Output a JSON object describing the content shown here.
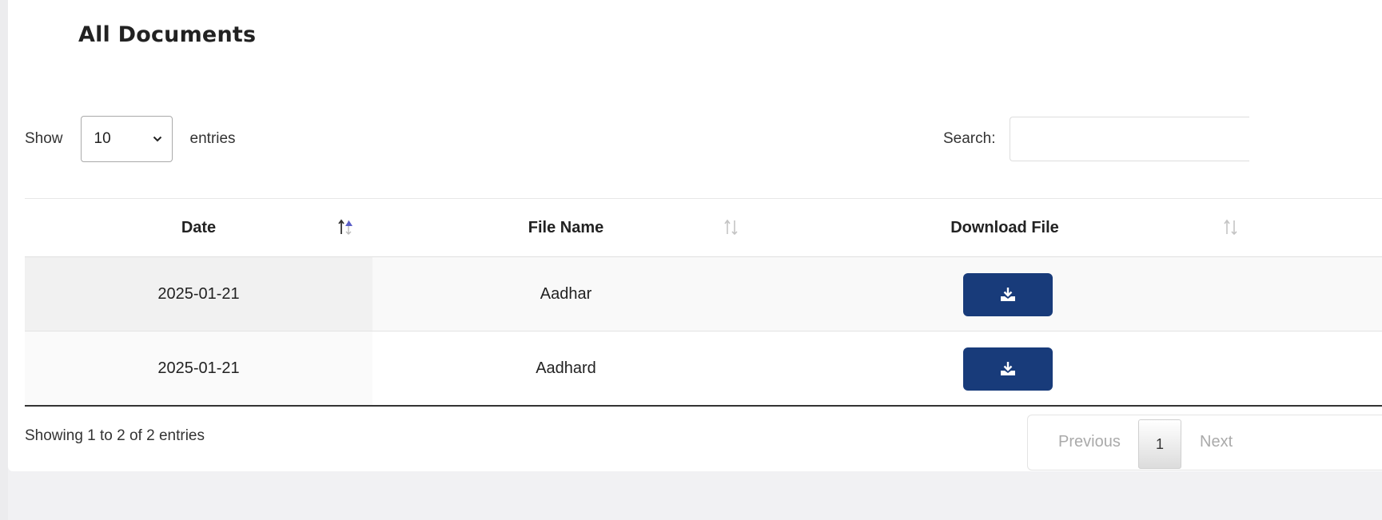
{
  "page_title": "All Documents",
  "length_control": {
    "prefix": "Show",
    "selected": "10",
    "suffix": "entries"
  },
  "search": {
    "label": "Search:",
    "value": ""
  },
  "table": {
    "columns": [
      "Date",
      "File Name",
      "Download File"
    ],
    "rows": [
      {
        "date": "2025-01-21",
        "file_name": "Aadhar"
      },
      {
        "date": "2025-01-21",
        "file_name": "Aadhard"
      }
    ]
  },
  "info_text": "Showing 1 to 2 of 2 entries",
  "pagination": {
    "previous": "Previous",
    "current": "1",
    "next": "Next"
  },
  "colors": {
    "download_button": "#183b7a",
    "sort_active": "#5b5fc7"
  },
  "icons": {
    "download": "download-icon",
    "sort": "sort-icon",
    "chevron": "chevron-down-icon"
  }
}
